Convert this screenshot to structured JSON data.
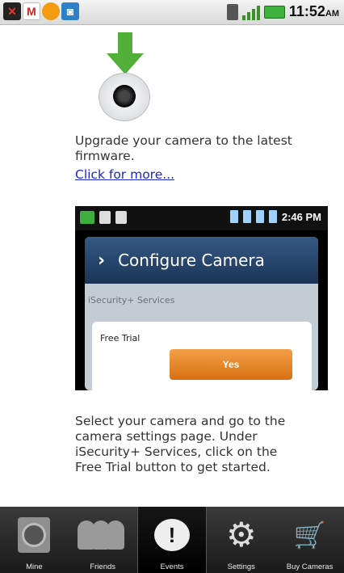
{
  "status_bar": {
    "time": "11:52",
    "ampm": "AM",
    "notification_icons": [
      "missed-call-icon",
      "gmail-icon",
      "orange-app-icon",
      "blue-app-icon"
    ]
  },
  "content": {
    "upgrade_text": "Upgrade your camera to the latest firmware.",
    "more_link": "Click for more...",
    "inset": {
      "time": "2:46 PM",
      "header_title": "Configure Camera",
      "services_label": "iSecurity+ Services",
      "free_trial_label": "Free Trial",
      "yes_button": "Yes"
    },
    "instructions": "Select your camera and go to the camera settings page. Under iSecurity+ Services, click on the Free Trial button to get started."
  },
  "tabs": [
    {
      "label": "Mine",
      "icon": "camera-icon",
      "active": false
    },
    {
      "label": "Friends",
      "icon": "friends-icon",
      "active": false
    },
    {
      "label": "Events",
      "icon": "alert-icon",
      "active": true
    },
    {
      "label": "Settings",
      "icon": "gear-icon",
      "active": false
    },
    {
      "label": "Buy Cameras",
      "icon": "cart-icon",
      "active": false
    }
  ],
  "colors": {
    "link": "#1a26d6",
    "accent_green": "#52b03a",
    "button_orange": "#e0801f"
  }
}
